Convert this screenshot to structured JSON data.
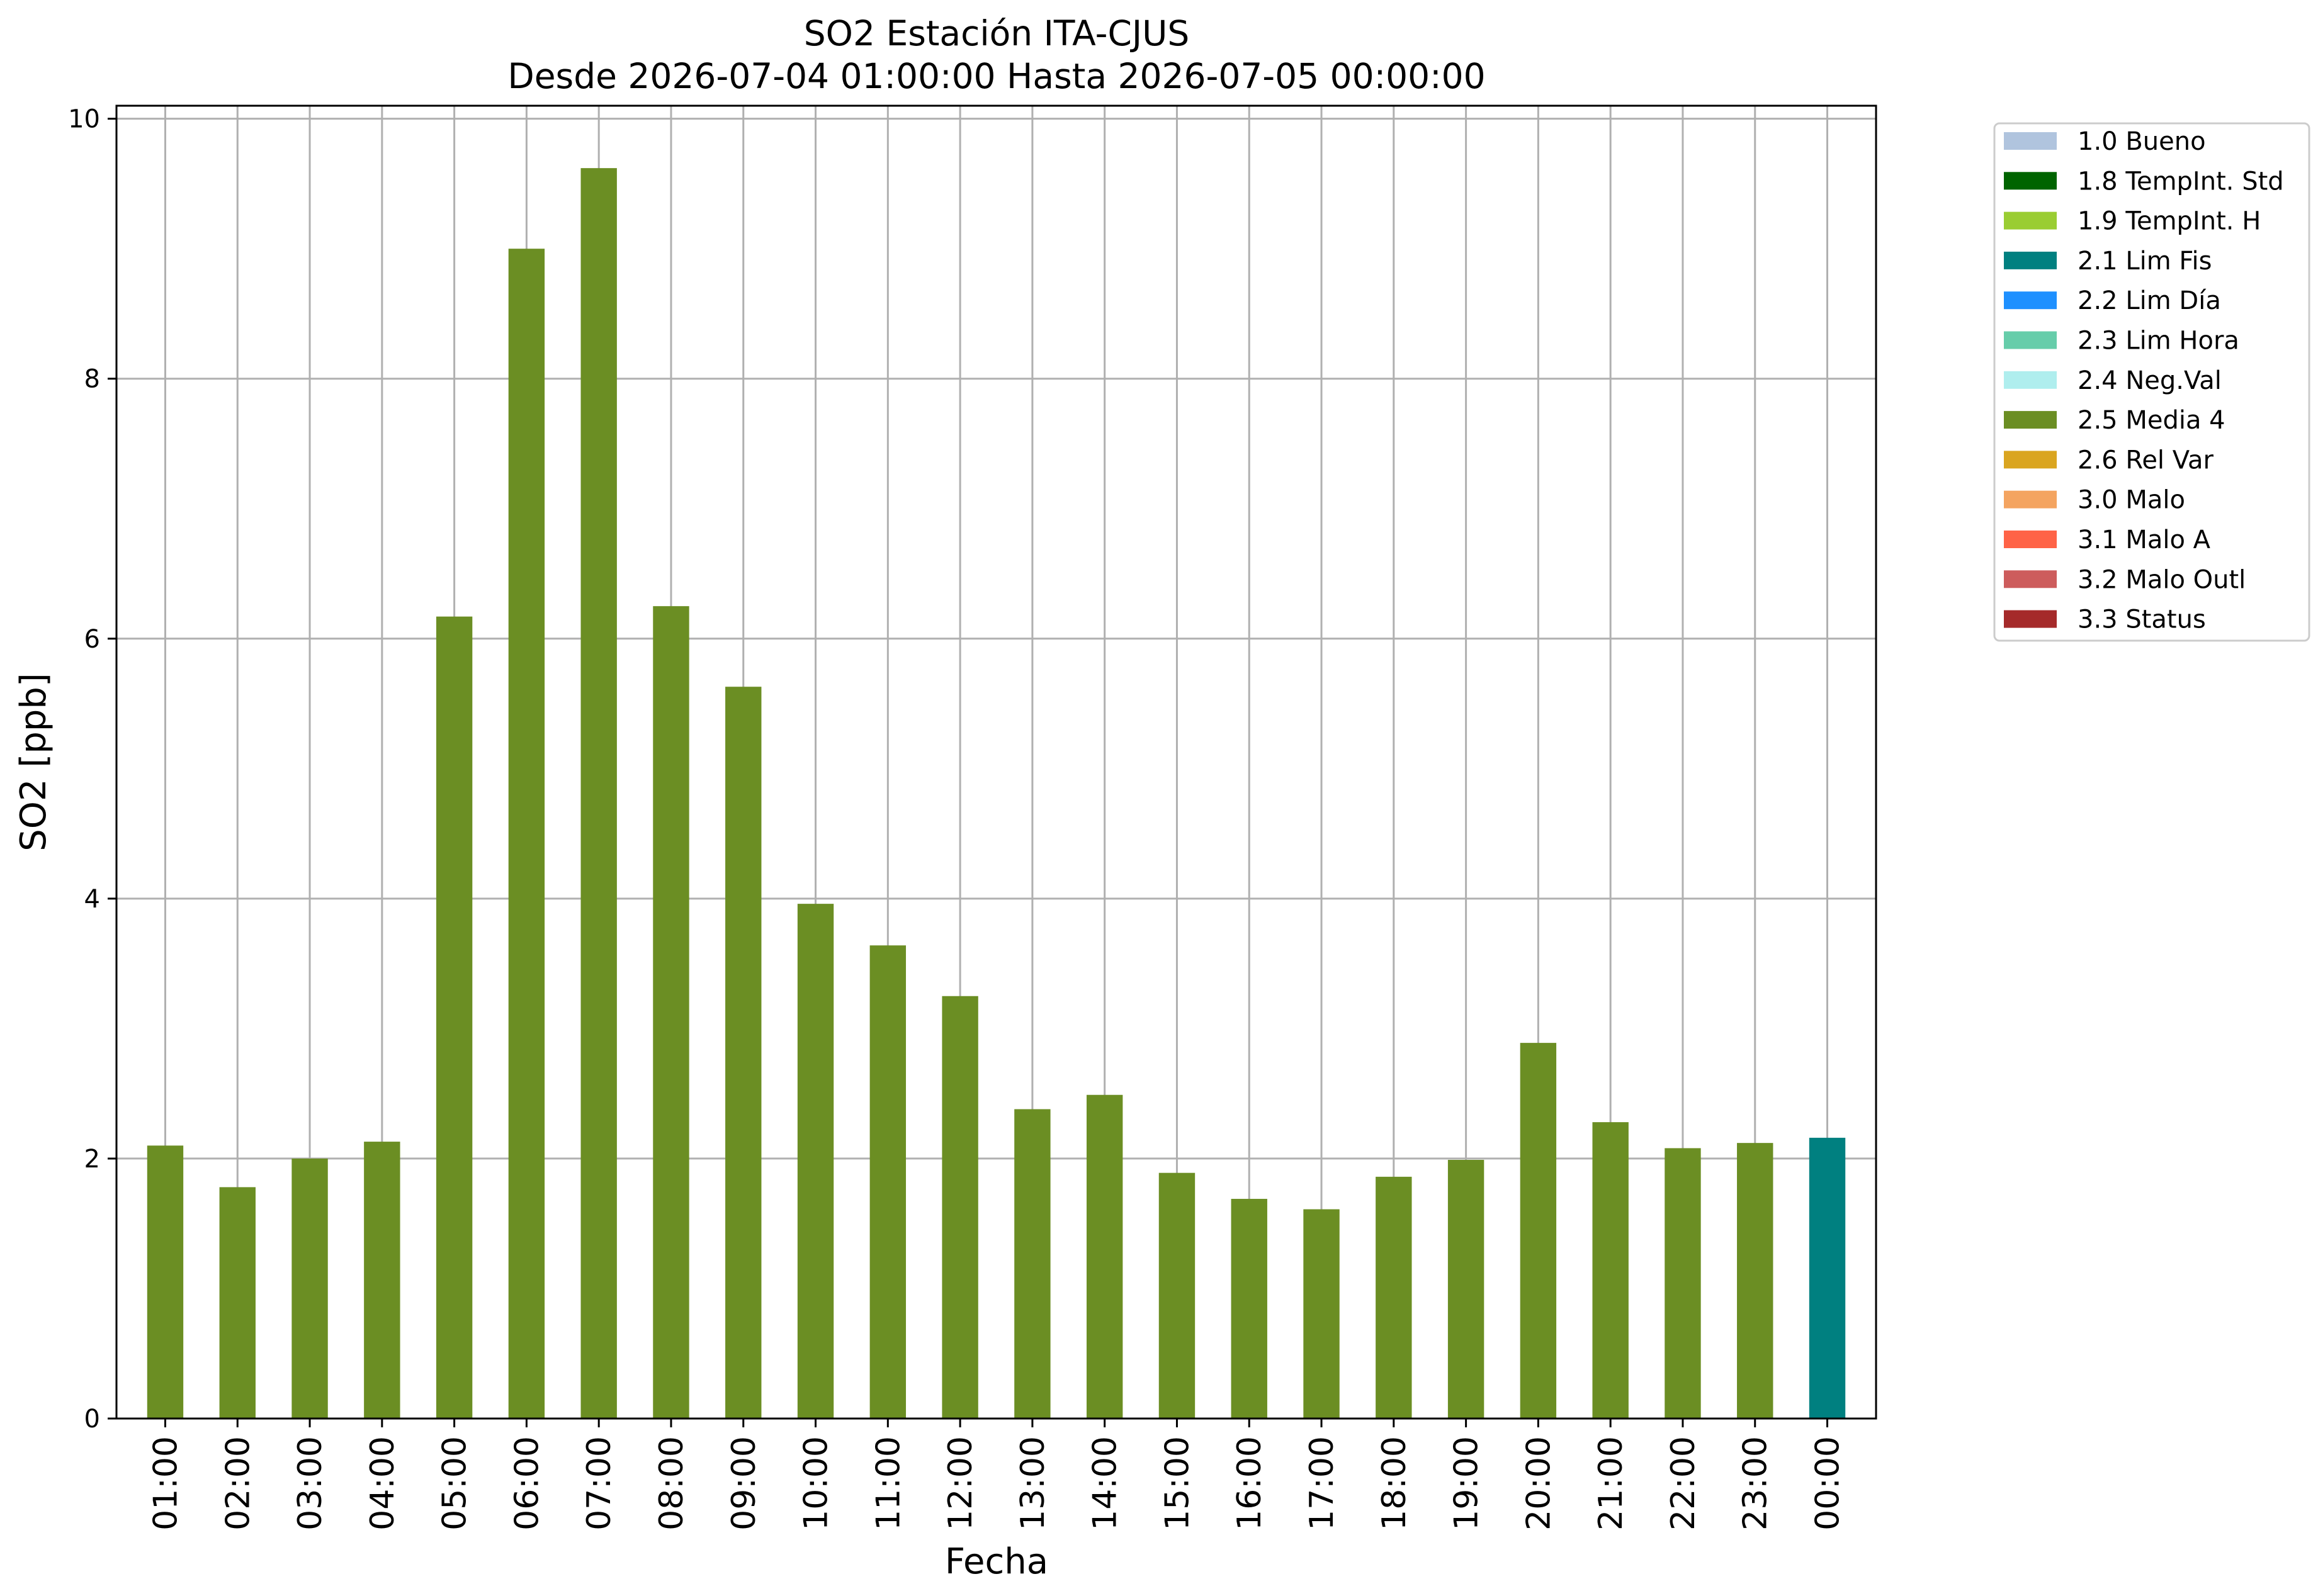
{
  "chart_data": {
    "type": "bar",
    "title": "SO2 Estación ITA-CJUS",
    "subtitle": "Desde 2026-07-04 01:00:00 Hasta 2026-07-05 00:00:00",
    "xlabel": "Fecha",
    "ylabel": "SO2 [ppb]",
    "ylim": [
      0,
      10.1
    ],
    "yticks": [
      "0",
      "2",
      "4",
      "6",
      "8",
      "10"
    ],
    "ytick_values": [
      0,
      2,
      4,
      6,
      8,
      10
    ],
    "grid": true,
    "legend_position": "outside-top-right",
    "categories": [
      "01:00",
      "02:00",
      "03:00",
      "04:00",
      "05:00",
      "06:00",
      "07:00",
      "08:00",
      "09:00",
      "10:00",
      "11:00",
      "12:00",
      "13:00",
      "14:00",
      "15:00",
      "16:00",
      "17:00",
      "18:00",
      "19:00",
      "20:00",
      "21:00",
      "22:00",
      "23:00",
      "00:00"
    ],
    "values": [
      2.1,
      1.78,
      2.0,
      2.13,
      6.17,
      9.0,
      9.62,
      6.25,
      5.63,
      3.96,
      3.64,
      3.25,
      2.38,
      2.49,
      1.89,
      1.69,
      1.61,
      1.86,
      1.99,
      2.89,
      2.28,
      2.08,
      2.12,
      2.16
    ],
    "bar_flags": [
      "2.5 Media 4",
      "2.5 Media 4",
      "2.5 Media 4",
      "2.5 Media 4",
      "2.5 Media 4",
      "2.5 Media 4",
      "2.5 Media 4",
      "2.5 Media 4",
      "2.5 Media 4",
      "2.5 Media 4",
      "2.5 Media 4",
      "2.5 Media 4",
      "2.5 Media 4",
      "2.5 Media 4",
      "2.5 Media 4",
      "2.5 Media 4",
      "2.5 Media 4",
      "2.5 Media 4",
      "2.5 Media 4",
      "2.5 Media 4",
      "2.5 Media 4",
      "2.5 Media 4",
      "2.5 Media 4",
      "2.1 Lim Fis"
    ],
    "legend": [
      {
        "label": "1.0 Bueno",
        "color": "#b0c4de"
      },
      {
        "label": "1.8 TempInt. Std",
        "color": "#006400"
      },
      {
        "label": "1.9 TempInt. H",
        "color": "#9acd32"
      },
      {
        "label": "2.1 Lim Fis",
        "color": "#008080"
      },
      {
        "label": "2.2 Lim Día",
        "color": "#1e90ff"
      },
      {
        "label": "2.3 Lim Hora",
        "color": "#66cdaa"
      },
      {
        "label": "2.4 Neg.Val",
        "color": "#afeeee"
      },
      {
        "label": "2.5 Media 4",
        "color": "#6b8e23"
      },
      {
        "label": "2.6 Rel Var",
        "color": "#daa520"
      },
      {
        "label": "3.0 Malo",
        "color": "#f4a460"
      },
      {
        "label": "3.1 Malo A",
        "color": "#ff6347"
      },
      {
        "label": "3.2 Malo Outl",
        "color": "#cd5c5c"
      },
      {
        "label": "3.3 Status",
        "color": "#a52a2a"
      }
    ]
  }
}
